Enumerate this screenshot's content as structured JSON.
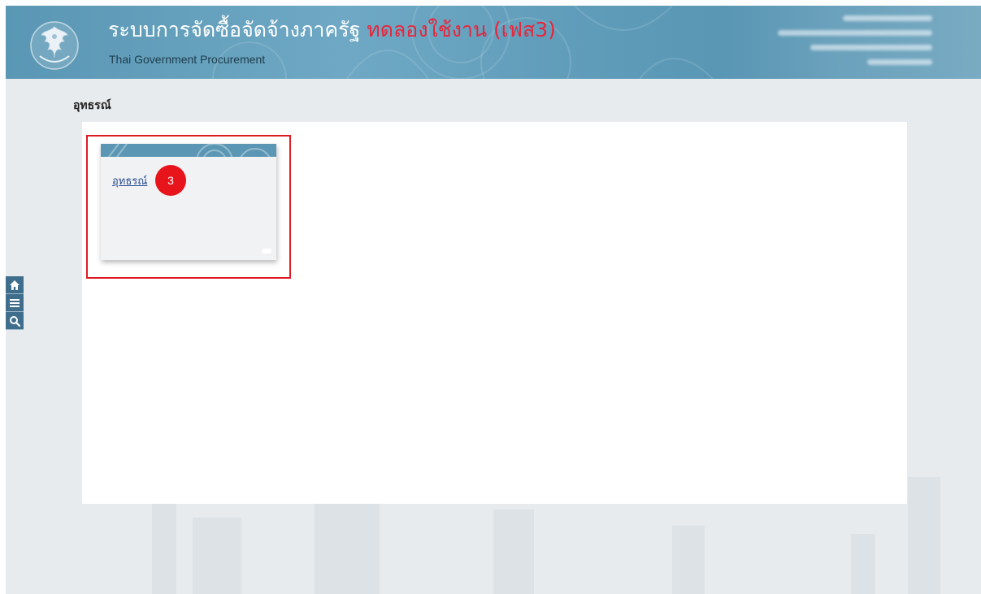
{
  "header": {
    "title_th": "ระบบการจัดซื้อจัดจ้างภาครัฐ",
    "title_trial": "ทดลองใช้งาน (เฟส3)",
    "subtitle_en": "Thai Government Procurement",
    "logo_icon": "garuda-emblem-icon",
    "accent_color": "#5b97b4",
    "trial_color": "#e9253a"
  },
  "breadcrumb": {
    "page_title": "อุทธรณ์"
  },
  "menu_cards": [
    {
      "label": "อุทธรณ์",
      "step_badge": "3",
      "icon": "card-banner-pattern"
    }
  ],
  "side_toolbar": [
    {
      "icon": "home-icon",
      "name": "home"
    },
    {
      "icon": "menu-icon",
      "name": "menu"
    },
    {
      "icon": "search-icon",
      "name": "search"
    }
  ],
  "colors": {
    "highlight_border": "#e01a22",
    "badge": "#e8141c",
    "toolbar": "#3f6d8c"
  }
}
